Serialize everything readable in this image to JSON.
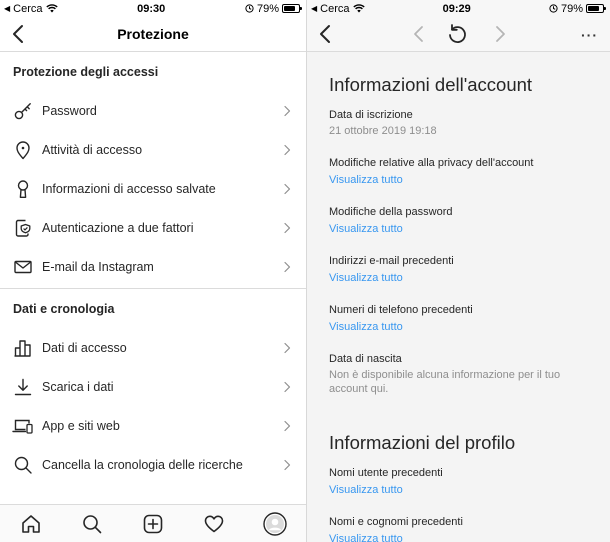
{
  "left": {
    "status": {
      "carrier": "Cerca",
      "time": "09:30",
      "battery": "79%",
      "battery_level": 0.79
    },
    "nav": {
      "title": "Protezione"
    },
    "sections": [
      {
        "title": "Protezione degli accessi",
        "items": [
          {
            "label": "Password",
            "icon": "key-icon"
          },
          {
            "label": "Attività di accesso",
            "icon": "location-pin-icon"
          },
          {
            "label": "Informazioni di accesso salvate",
            "icon": "keyhole-icon"
          },
          {
            "label": "Autenticazione a due fattori",
            "icon": "phone-shield-icon"
          },
          {
            "label": "E-mail da Instagram",
            "icon": "envelope-icon"
          }
        ]
      },
      {
        "title": "Dati e cronologia",
        "items": [
          {
            "label": "Dati di accesso",
            "icon": "bar-chart-icon"
          },
          {
            "label": "Scarica i dati",
            "icon": "download-icon"
          },
          {
            "label": "App e siti web",
            "icon": "laptop-phone-icon"
          },
          {
            "label": "Cancella la cronologia delle ricerche",
            "icon": "search-icon"
          }
        ]
      }
    ],
    "tabbar": [
      "home-icon",
      "search-icon",
      "add-post-icon",
      "heart-icon",
      "profile-avatar"
    ]
  },
  "right": {
    "status": {
      "carrier": "Cerca",
      "time": "09:29",
      "battery": "79%",
      "battery_level": 0.79
    },
    "account": {
      "title": "Informazioni dell'account",
      "items": [
        {
          "label": "Data di iscrizione",
          "value": "21 ottobre 2019 19:18"
        },
        {
          "label": "Modifiche relative alla privacy dell'account",
          "link": "Visualizza tutto"
        },
        {
          "label": "Modifiche della password",
          "link": "Visualizza tutto"
        },
        {
          "label": "Indirizzi e-mail precedenti",
          "link": "Visualizza tutto"
        },
        {
          "label": "Numeri di telefono precedenti",
          "link": "Visualizza tutto"
        },
        {
          "label": "Data di nascita",
          "value": "Non è disponibile alcuna informazione per il tuo account qui."
        }
      ]
    },
    "profile": {
      "title": "Informazioni del profilo",
      "items": [
        {
          "label": "Nomi utente precedenti",
          "link": "Visualizza tutto"
        },
        {
          "label": "Nomi e cognomi precedenti",
          "link": "Visualizza tutto"
        }
      ]
    }
  }
}
